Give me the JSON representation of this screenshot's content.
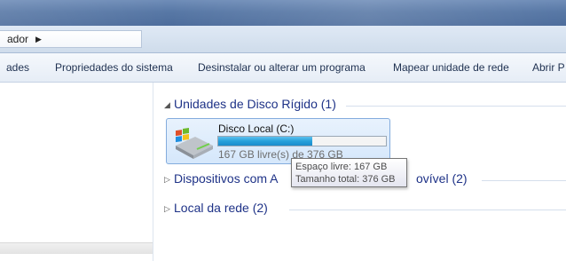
{
  "address": {
    "crumb": "ador",
    "arrow_icon": "chevron-right-icon"
  },
  "toolbar": {
    "items": [
      "ades",
      "Propriedades do sistema",
      "Desinstalar ou alterar um programa",
      "Mapear unidade de rede",
      "Abrir P"
    ]
  },
  "groups": [
    {
      "label": "Unidades de Disco Rígido (1)",
      "expanded": true
    },
    {
      "label": "Dispositivos com A",
      "label_tail": "ovível (2)",
      "expanded": false
    },
    {
      "label": "Local da rede (2)",
      "expanded": false
    }
  ],
  "drive": {
    "name": "Disco Local (C:)",
    "free_text": "167 GB livre(s) de 376 GB",
    "used_fraction": 0.56,
    "icon": "windows-drive-icon"
  },
  "tooltip": {
    "line1": "Espaço livre: 167 GB",
    "line2": "Tamanho total: 376 GB"
  },
  "colors": {
    "accent": "#1e3287",
    "progress": "#26a0da"
  }
}
